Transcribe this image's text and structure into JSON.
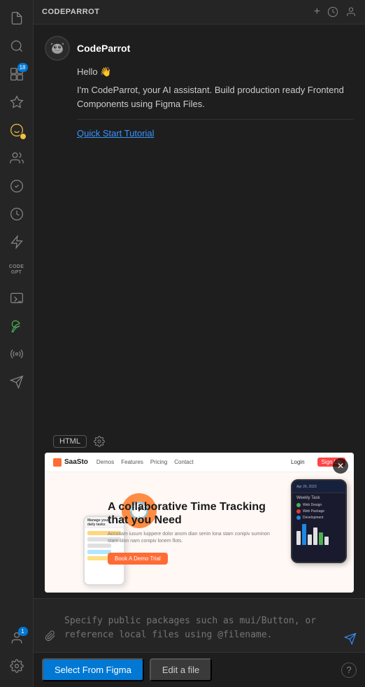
{
  "sidebar": {
    "title": "CODEPARROT",
    "icons": [
      {
        "name": "files-icon",
        "symbol": "⎘",
        "active": false,
        "badge": null
      },
      {
        "name": "search-icon",
        "symbol": "🔍",
        "active": false,
        "badge": null
      },
      {
        "name": "extensions-icon",
        "symbol": "⊞",
        "active": false,
        "badge": "18"
      },
      {
        "name": "star-icon",
        "symbol": "✦",
        "active": false,
        "badge": null
      },
      {
        "name": "codeparrot-icon",
        "symbol": "🦜",
        "active": true,
        "badge": null
      },
      {
        "name": "team-icon",
        "symbol": "👥",
        "active": false,
        "badge": null
      },
      {
        "name": "check-icon",
        "symbol": "✓",
        "active": false,
        "badge": null
      },
      {
        "name": "history-icon",
        "symbol": "⊙",
        "active": false,
        "badge": null
      },
      {
        "name": "lightning-icon",
        "symbol": "⚡",
        "active": false,
        "badge": null
      },
      {
        "name": "codegpt-icon",
        "symbol": "CODE\nGPT",
        "active": false,
        "badge": null
      },
      {
        "name": "terminal-icon",
        "symbol": "▭",
        "active": false,
        "badge": null
      },
      {
        "name": "leaf-icon",
        "symbol": "🌿",
        "active": false,
        "badge": null
      },
      {
        "name": "radio-icon",
        "symbol": "◉",
        "active": false,
        "badge": null
      },
      {
        "name": "bird-icon",
        "symbol": "🐦",
        "active": false,
        "badge": null
      }
    ],
    "bottom_icons": [
      {
        "name": "user-icon",
        "symbol": "👤",
        "badge": "1"
      },
      {
        "name": "settings-icon",
        "symbol": "⚙",
        "badge": null
      }
    ]
  },
  "topbar": {
    "title": "CODEPARROT",
    "actions": {
      "add_label": "+",
      "history_label": "🕐",
      "account_label": "👤"
    }
  },
  "assistant": {
    "name": "CodeParrot",
    "avatar_emoji": "🦜",
    "greeting": "Hello 👋",
    "description": "I'm CodeParrot, your AI assistant. Build production ready Frontend Components using Figma Files.",
    "quick_start_label": "Quick Start Tutorial"
  },
  "preview": {
    "close_label": "✕",
    "saasto": {
      "brand": "SaaSto",
      "nav_links": [
        "Demos",
        "Features",
        "Pricing",
        "Contact"
      ],
      "login_label": "Login",
      "signup_label": "Sign Up",
      "hero_title": "A collaborative Time Tracking that you Need",
      "hero_sub": "Accusam iusum luippere dolor anom dian serim lona\nstam conipiv suminon stam olon nam conipiv lonem flots.",
      "hero_btn": "Book A Demo Trial",
      "phone_left_label": "Manage your\ndaily tasks",
      "phone_right_date": "Apr 26, 2023",
      "phone_right_title": "Weekly Task",
      "tasks": [
        {
          "color": "#4caf50",
          "label": "Web Design"
        },
        {
          "color": "#f44336",
          "label": "Web Package"
        },
        {
          "color": "#2196f3",
          "label": ""
        }
      ]
    }
  },
  "toolbar": {
    "html_label": "HTML",
    "settings_label": "⚙"
  },
  "input": {
    "placeholder": "Specify public packages such as mui/Button, or reference local files using @filename.",
    "attach_icon": "📎",
    "send_icon": "➤"
  },
  "footer": {
    "select_figma_label": "Select From Figma",
    "edit_file_label": "Edit a file",
    "help_label": "?"
  }
}
